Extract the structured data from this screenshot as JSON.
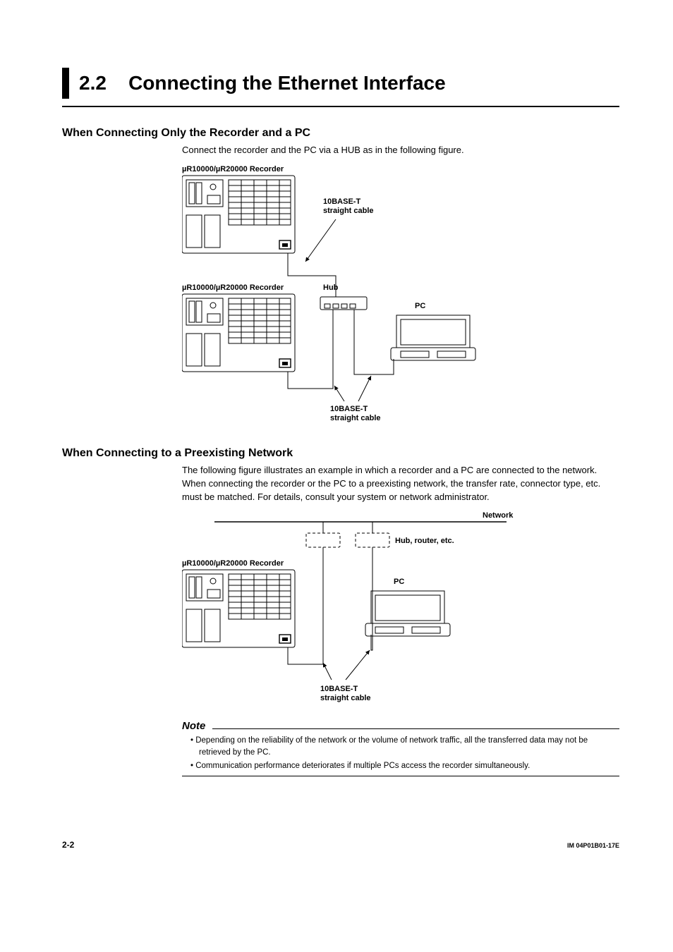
{
  "title": {
    "num": "2.2",
    "text": "Connecting the Ethernet Interface"
  },
  "section1": {
    "heading": "When Connecting Only the Recorder and a PC",
    "para": "Connect the recorder and the PC via a HUB as in the following figure."
  },
  "fig1": {
    "rec1": "R10000/µR20000 Recorder",
    "rec2": "R10000/µR20000 Recorder",
    "cable1_a": "10BASE-T",
    "cable1_b": "straight cable",
    "cable2_a": "10BASE-T",
    "cable2_b": "straight cable",
    "hub": "Hub",
    "pc": "PC"
  },
  "section2": {
    "heading": "When Connecting to a Preexisting Network",
    "para": "The following figure illustrates an example in which a recorder and a PC are connected to the network. When connecting the recorder or the PC to a preexisting network, the transfer rate, connector type, etc. must be matched. For details, consult your system or network administrator."
  },
  "fig2": {
    "rec": "R10000/µR20000 Recorder",
    "network": "Network",
    "hubrouter": "Hub, router, etc.",
    "pc": "PC",
    "cable_a": "10BASE-T",
    "cable_b": "straight cable"
  },
  "note": {
    "heading": "Note",
    "item1": "Depending on the reliability of the network or the volume of network traffic, all the transferred data may not be retrieved by the PC.",
    "item2": "Communication performance deteriorates if multiple PCs access the recorder simultaneously."
  },
  "footer": {
    "page": "2-2",
    "docid": "IM 04P01B01-17E"
  }
}
